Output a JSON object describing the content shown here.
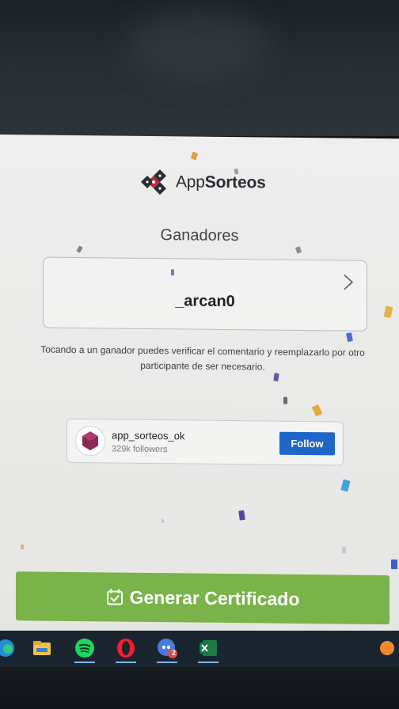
{
  "app": {
    "logo_text_app": "App",
    "logo_text_sorteos": "Sorteos"
  },
  "winners": {
    "title": "Ganadores",
    "winner_name": "_arcan0"
  },
  "hint_text": "Tocando a un ganador puedes verificar el comentario y reemplazarlo por otro participante de ser necesario.",
  "instagram": {
    "username": "app_sorteos_ok",
    "followers": "329k followers",
    "follow_label": "Follow"
  },
  "cta": {
    "label": "Generar Certificado"
  },
  "taskbar": {
    "items": [
      "edge-icon",
      "file-explorer-icon",
      "spotify-icon",
      "opera-icon",
      "discord-icon",
      "excel-icon"
    ],
    "discord_badge": "2"
  },
  "colors": {
    "accent_green": "#79b34a",
    "follow_blue": "#1f66c8",
    "logo_red": "#c0283c",
    "logo_dark": "#2a2d34"
  }
}
